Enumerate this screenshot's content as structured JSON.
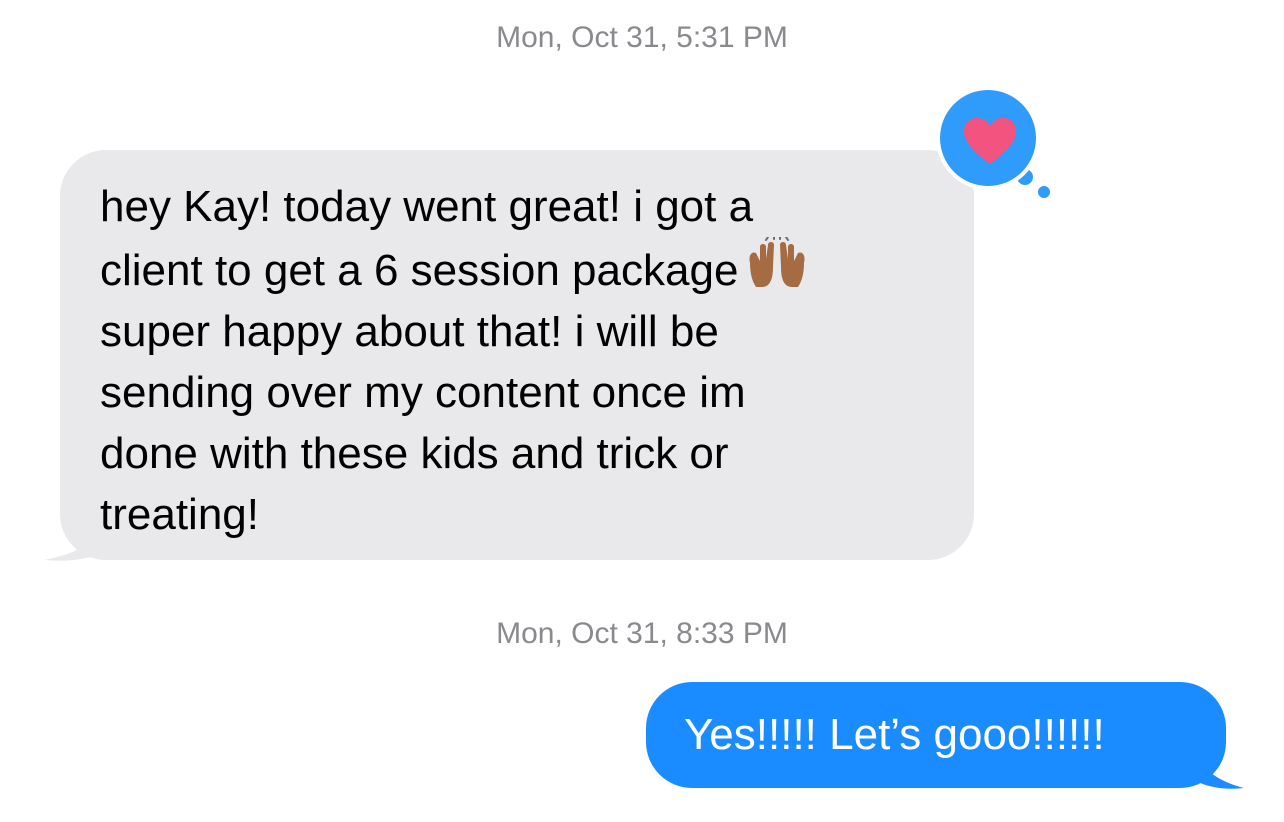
{
  "conversation": {
    "timestamps": [
      "Mon, Oct 31, 5:31 PM",
      "Mon, Oct 31, 8:33 PM"
    ],
    "incoming_message": {
      "lines": [
        "hey Kay! today went great! i got a",
        "client to get a 6 session package",
        "super happy about that! i will be",
        "sending over my content once im",
        "done with these kids and trick or",
        "treating!"
      ],
      "emoji": "raising-hands-medium-skin-tone",
      "reaction": "heart"
    },
    "outgoing_message": {
      "text": "Yes!!!!! Let’s gooo!!!!!!"
    }
  },
  "colors": {
    "incoming_bubble": "#e9e9eb",
    "outgoing_bubble": "#1b8cff",
    "reaction_bubble": "#2f9bfb",
    "heart": "#f2547f",
    "timestamp_text": "#8a8a8e"
  }
}
